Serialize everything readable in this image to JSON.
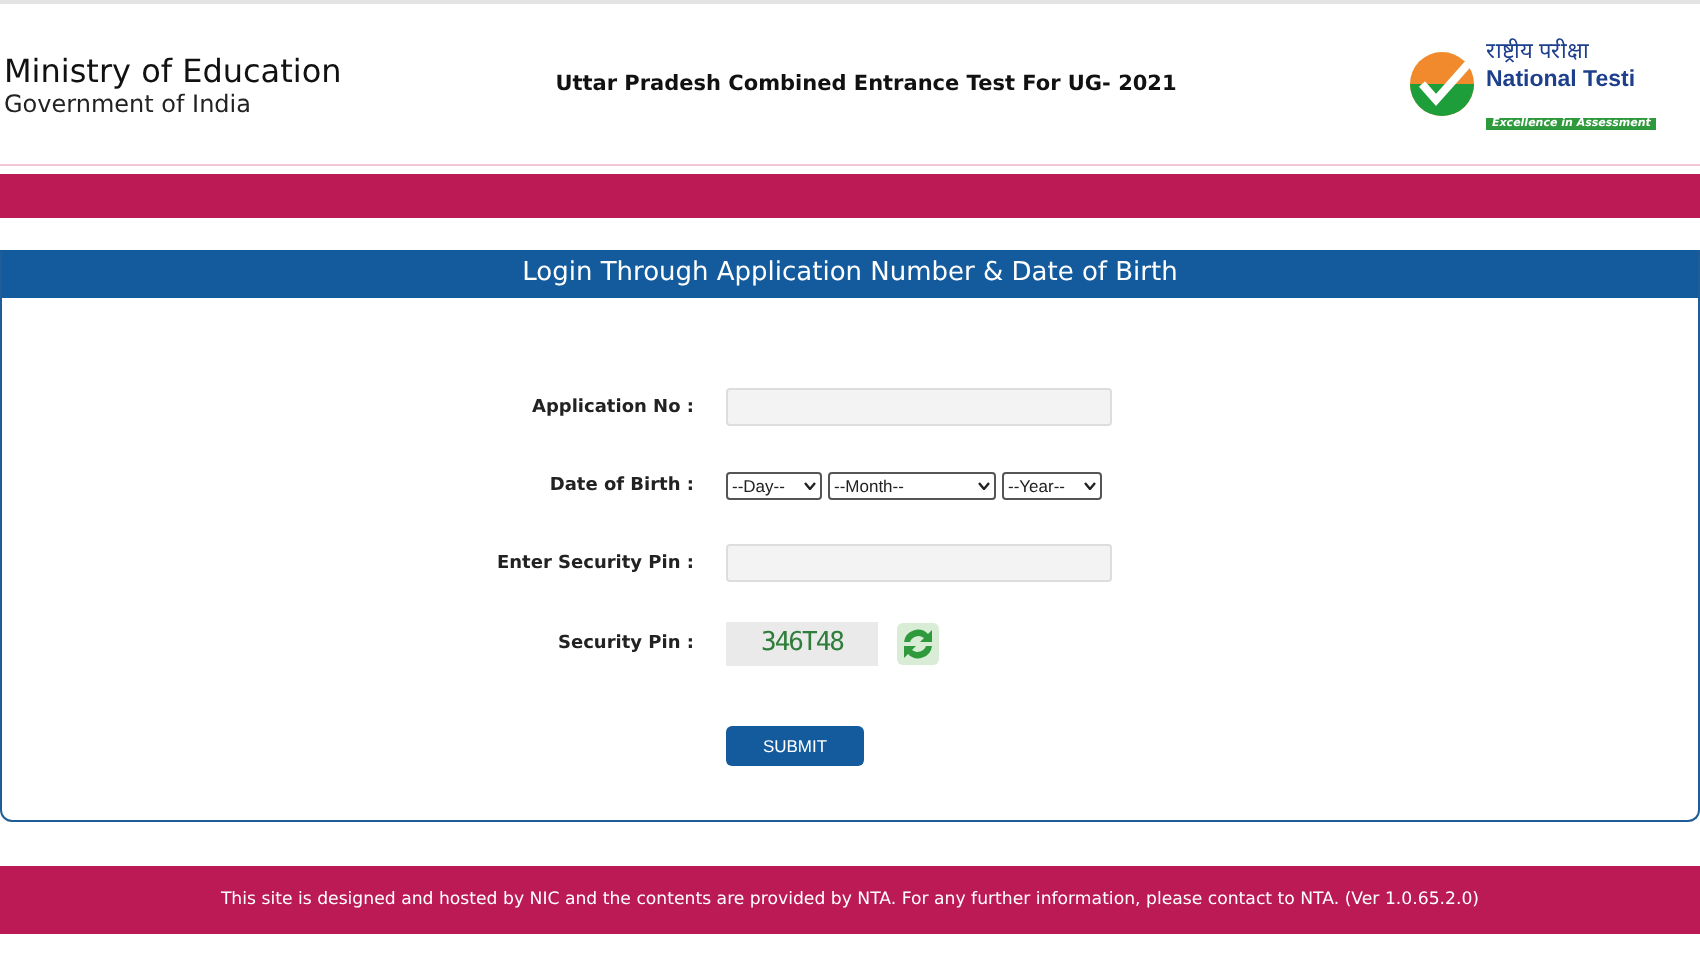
{
  "header": {
    "ministry": "Ministry of Education",
    "government": "Government of India",
    "exam_title": "Uttar Pradesh Combined Entrance Test For UG- 2021",
    "logo_hindi": "राष्ट्रीय परीक्षा",
    "logo_english": "National Testi",
    "logo_tagline": "Excellence in Assessment"
  },
  "login_panel": {
    "title": "Login Through Application Number & Date of Birth",
    "fields": [
      {
        "kind": "text",
        "label": "Application No :"
      },
      {
        "kind": "date",
        "label": "Date of Birth :",
        "selects": [
          "--Day--",
          "--Month--",
          "--Year--"
        ]
      },
      {
        "kind": "text",
        "label": "Enter Security Pin :"
      },
      {
        "kind": "captcha",
        "label": "Security Pin :",
        "code": "346T48"
      }
    ],
    "submit": "SUBMIT"
  },
  "footer": "This site is designed and hosted by NIC and the contents are provided by NTA. For any further information, please contact to NTA. (Ver 1.0.65.2.0)"
}
